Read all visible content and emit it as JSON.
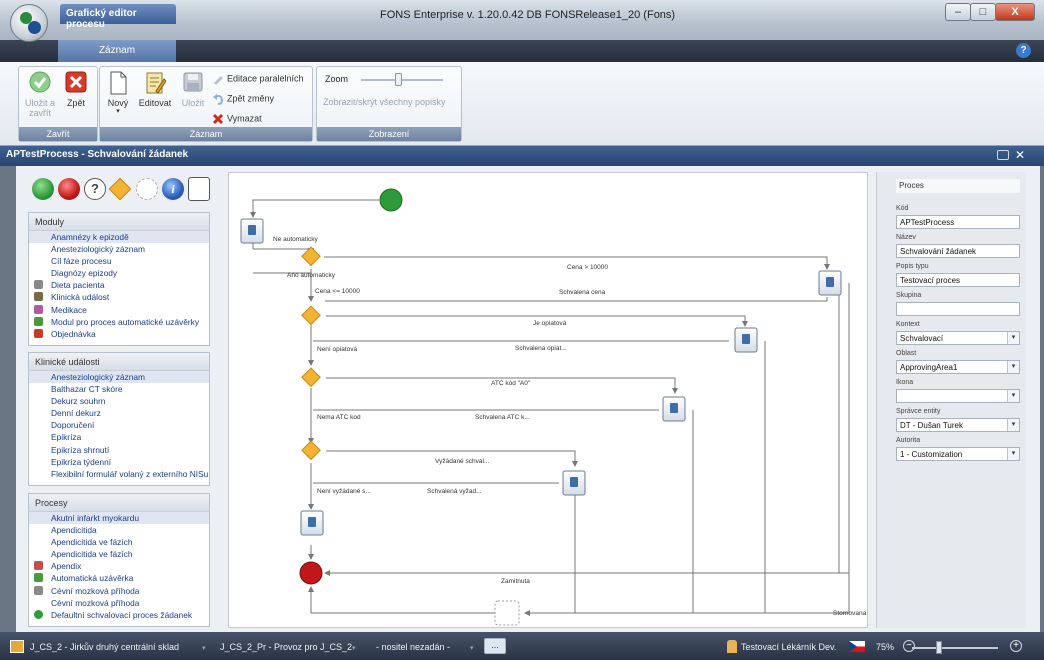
{
  "window": {
    "title": "FONS Enterprise v. 1.20.0.42 DB FONSRelease1_20 (Fons)",
    "context_tab": "Grafický editor procesu",
    "ribbon_tab": "Záznam",
    "min_label": "–",
    "max_label": "□",
    "close_label": "X",
    "help_label": "?"
  },
  "ribbon": {
    "zavrit": {
      "caption": "Zavřít",
      "save_close_label": "Uložit a zavřít",
      "back_label": "Zpět"
    },
    "zaznam": {
      "caption": "Záznam",
      "new_label": "Nový",
      "edit_label": "Editovat",
      "save_label": "Uložit",
      "edit_parallel_label": "Editace paralelních",
      "undo_label": "Zpět změny",
      "delete_label": "Vymazat"
    },
    "zobrazeni": {
      "caption": "Zobrazení",
      "zoom_label": "Zoom",
      "zoom_level": 0.45,
      "toggle_labels": "Zobrazit/skrýt všechny popisky"
    }
  },
  "document": {
    "title": "APTestProcess - Schvalování žádanek",
    "close_label": "✕"
  },
  "palette": {
    "help_glyph": "?",
    "info_glyph": "i"
  },
  "lists": {
    "moduly": {
      "header": "Moduly",
      "items": [
        {
          "label": "Anamnézy k epizodě",
          "icon": "",
          "selected": true
        },
        {
          "label": "Anesteziologický záznam",
          "icon": ""
        },
        {
          "label": "Cíl fáze procesu",
          "icon": ""
        },
        {
          "label": "Diagnózy epizody",
          "icon": ""
        },
        {
          "label": "Dieta pacienta",
          "icon": "fork-knife-icon",
          "color": "#8a8a8a"
        },
        {
          "label": "Klinická událost",
          "icon": "clipboard-icon",
          "color": "#7a6a4a"
        },
        {
          "label": "Medikace",
          "icon": "pill-icon",
          "color": "#b05aa0"
        },
        {
          "label": "Modul pro proces automatické uzávěrky",
          "icon": "lock-icon",
          "color": "#4a9a3a"
        },
        {
          "label": "Objednávka",
          "icon": "order-icon",
          "color": "#c83a2a"
        }
      ]
    },
    "udalosti": {
      "header": "Klinické události",
      "items": [
        {
          "label": "Anesteziologický záznam",
          "selected": true
        },
        {
          "label": "Balthazar CT skóre"
        },
        {
          "label": "Dekurz souhrn"
        },
        {
          "label": "Denní dekurz"
        },
        {
          "label": "Doporučení"
        },
        {
          "label": "Epikríza"
        },
        {
          "label": "Epikríza shrnutí"
        },
        {
          "label": "Epikríza týdenní"
        },
        {
          "label": "Flexibilní formulář volaný z externího NISu"
        }
      ]
    },
    "procesy": {
      "header": "Procesy",
      "items": [
        {
          "label": "Akutní infarkt myokardu",
          "selected": true
        },
        {
          "label": "Apendicitida"
        },
        {
          "label": "Apendicitida ve fázích"
        },
        {
          "label": "Apendicitida ve fázích"
        },
        {
          "label": "Apendix",
          "icon": "person-icon",
          "color": "#c0504d"
        },
        {
          "label": "Automatická uzávěrka",
          "icon": "lock-icon",
          "color": "#4a9a3a"
        },
        {
          "label": "Cévní mozková příhoda",
          "icon": "person-icon",
          "color": "#8a8a8a"
        },
        {
          "label": "Cévní mozková příhoda"
        },
        {
          "label": "Defaultní schvalovací proces žádanek",
          "icon": "green-circle-icon",
          "color": "#2e9a3a"
        }
      ]
    }
  },
  "diagram": {
    "labels": {
      "ne_automaticky": "Ne automaticky",
      "ano_automaticky": "Ano automaticky",
      "cena_gt": "Cena > 10000",
      "cena_le": "Cena <= 10000",
      "schvalena_cena": "Schvalena cena",
      "je_opiatova": "Je opiatová",
      "neni_opiatova": "Není opiatová",
      "schvalena_opiat": "Schvalena opiat...",
      "atc_kod": "ATC kód \"A0\"",
      "nema_atc": "Nema ATC kod",
      "schvalena_atc": "Schvalena ATC k...",
      "vyzadane_schval": "Vyžádané schval...",
      "neni_vyzadane": "Není vyžádané s...",
      "schvalena_vyzad": "Schvalená vyžad...",
      "zamitnuta": "Zamitnuta",
      "stornovana": "Stornovana"
    }
  },
  "properties": {
    "title": "Proces",
    "fields": [
      {
        "label": "Kód",
        "value": "APTestProcess",
        "dropdown": false
      },
      {
        "label": "Název",
        "value": "Schvalování žádanek",
        "dropdown": false
      },
      {
        "label": "Popis typu",
        "value": "Testovací proces",
        "dropdown": false
      },
      {
        "label": "Skupina",
        "value": "",
        "dropdown": false
      },
      {
        "label": "Kontext",
        "value": "Schvalovací",
        "dropdown": true
      },
      {
        "label": "Oblast",
        "value": "ApprovingArea1",
        "dropdown": true
      },
      {
        "label": "Ikona",
        "value": "",
        "dropdown": true
      },
      {
        "label": "Správce entity",
        "value": "DT - Dušan Turek",
        "dropdown": true
      },
      {
        "label": "Autorita",
        "value": "1 - Customization",
        "dropdown": true
      }
    ]
  },
  "statusbar": {
    "location": "J_CS_2 - Jirkův druhý centrální sklad",
    "provoz": "J_CS_2_Pr - Provoz pro J_CS_2",
    "nositel": "- nositel nezadán -",
    "more": "...",
    "user": "Testovací Lékárník Dev.",
    "zoom_text": "75%",
    "zoom_level": 0.3
  },
  "colors": {
    "accent": "#3f6191",
    "start_green": "#2e9a3a",
    "end_red": "#c01818",
    "decision": "#f2b233"
  }
}
